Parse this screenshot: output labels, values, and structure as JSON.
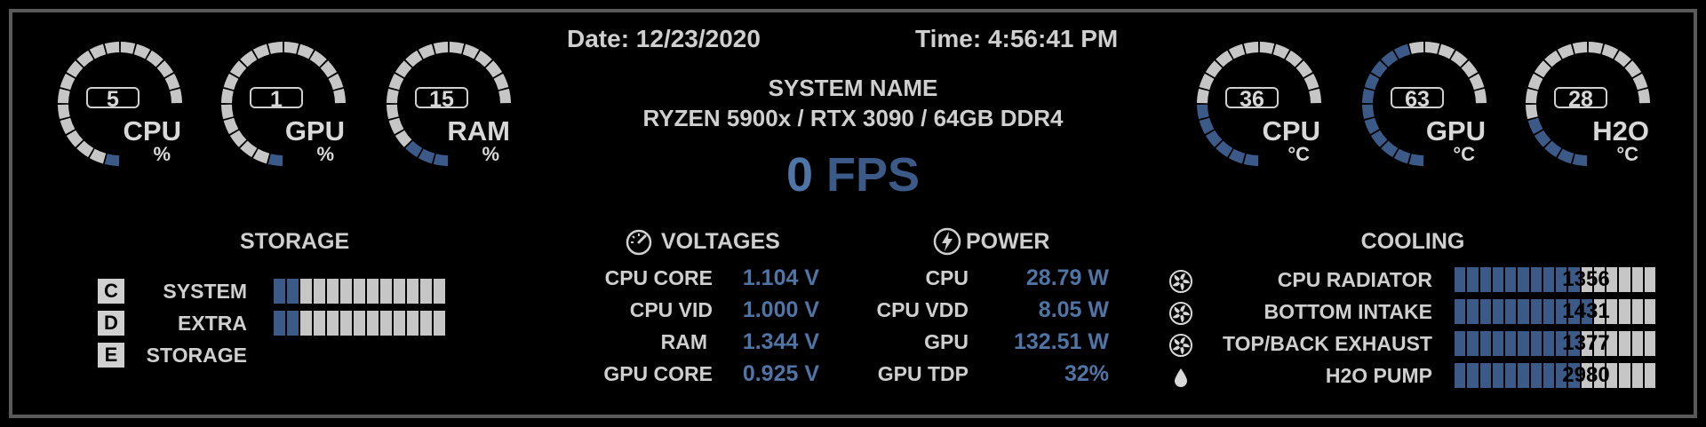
{
  "header": {
    "date": "Date: 12/23/2020",
    "time": "Time: 4:56:41 PM",
    "system_name": "SYSTEM NAME",
    "system_spec": "RYZEN 5900x / RTX 3090 / 64GB DDR4",
    "fps_value": "0",
    "fps_unit": "FPS"
  },
  "usage_gauges": [
    {
      "value": "5",
      "label": "CPU",
      "unit": "%",
      "level": 0.05
    },
    {
      "value": "1",
      "label": "GPU",
      "unit": "%",
      "level": 0.01
    },
    {
      "value": "15",
      "label": "RAM",
      "unit": "%",
      "level": 0.15
    }
  ],
  "temp_gauges": [
    {
      "value": "36",
      "label": "CPU",
      "unit": "°C",
      "level": 0.36
    },
    {
      "value": "63",
      "label": "GPU",
      "unit": "°C",
      "level": 0.63
    },
    {
      "value": "28",
      "label": "H2O",
      "unit": "°C",
      "level": 0.28
    }
  ],
  "storage": {
    "title": "STORAGE",
    "drives": [
      {
        "letter": "C",
        "name": "SYSTEM",
        "usage": 0.12,
        "bar": true
      },
      {
        "letter": "D",
        "name": "EXTRA",
        "usage": 0.12,
        "bar": true
      },
      {
        "letter": "E",
        "name": "STORAGE",
        "usage": 0,
        "bar": false
      }
    ]
  },
  "voltages": {
    "title": "VOLTAGES",
    "icon": "gauge-icon",
    "rows": [
      {
        "label": "CPU CORE",
        "value": "1.104 V"
      },
      {
        "label": "CPU VID",
        "value": "1.000 V"
      },
      {
        "label": "RAM",
        "value": "1.344 V"
      },
      {
        "label": "GPU CORE",
        "value": "0.925 V"
      }
    ]
  },
  "power": {
    "title": "POWER",
    "icon": "lightning-icon",
    "rows": [
      {
        "label": "CPU",
        "value": "28.79 W"
      },
      {
        "label": "CPU VDD",
        "value": "8.05 W"
      },
      {
        "label": "GPU",
        "value": "132.51 W"
      },
      {
        "label": "GPU TDP",
        "value": "32%"
      }
    ]
  },
  "cooling": {
    "title": "COOLING",
    "rows": [
      {
        "icon": "fan-icon",
        "label": "CPU RADIATOR",
        "value": "1356",
        "level": 0.62
      },
      {
        "icon": "fan-icon",
        "label": "BOTTOM INTAKE",
        "value": "1431",
        "level": 0.66
      },
      {
        "icon": "fan-icon",
        "label": "TOP/BACK EXHAUST",
        "value": "1377",
        "level": 0.62
      },
      {
        "icon": "droplet-icon",
        "label": "H2O PUMP",
        "value": "2980",
        "level": 0.62
      }
    ]
  },
  "colors": {
    "accent": "#3c5a87",
    "value_text": "#4f74a6",
    "track": "#c6c6c6",
    "frame": "#5a5a5a"
  }
}
